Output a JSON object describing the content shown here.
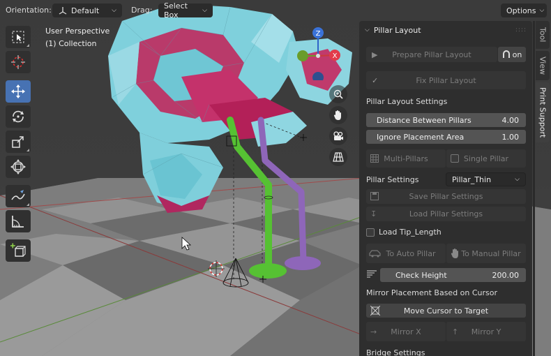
{
  "header": {
    "orientation_label": "Orientation:",
    "orientation_value": "Default",
    "drag_label": "Drag:",
    "drag_value": "Select Box",
    "options_label": "Options"
  },
  "viewport": {
    "perspective": "User Perspective",
    "collection": "(1) Collection",
    "gizmo_axes": [
      "Z",
      "X"
    ]
  },
  "toolbar": {
    "tools": [
      "select-box",
      "cursor",
      "move",
      "rotate",
      "scale",
      "transform",
      "annotate",
      "measure",
      "add-cube"
    ],
    "active": "move"
  },
  "panel": {
    "title": "Pillar Layout",
    "prepare_button": "Prepare Pillar Layout",
    "toggle_label": "on",
    "fix_button": "Fix Pillar Layout",
    "settings_heading": "Pillar Layout Settings",
    "distance_label": "Distance Between Pillars",
    "distance_value": "4.00",
    "ignore_label": "Ignore Placement Area",
    "ignore_value": "1.00",
    "multi_pillars": "Multi-Pillars",
    "single_pillar": "Single Pillar",
    "pillar_settings_label": "Pillar Settings",
    "pillar_settings_value": "Pillar_Thin",
    "save_settings": "Save Pillar Settings",
    "load_settings": "Load Pillar Settings",
    "load_tip": "Load Tip_Length",
    "to_auto": "To Auto Pillar",
    "to_manual": "To Manual Pillar",
    "check_height_label": "Check Height",
    "check_height_value": "200.00",
    "mirror_heading": "Mirror Placement Based on Cursor",
    "move_cursor": "Move Cursor to Target",
    "mirror_x": "Mirror X",
    "mirror_y": "Mirror Y",
    "bridge_heading": "Bridge Settings"
  },
  "tabs": [
    "Tool",
    "View",
    "Print Support"
  ],
  "active_tab": "Print Support"
}
